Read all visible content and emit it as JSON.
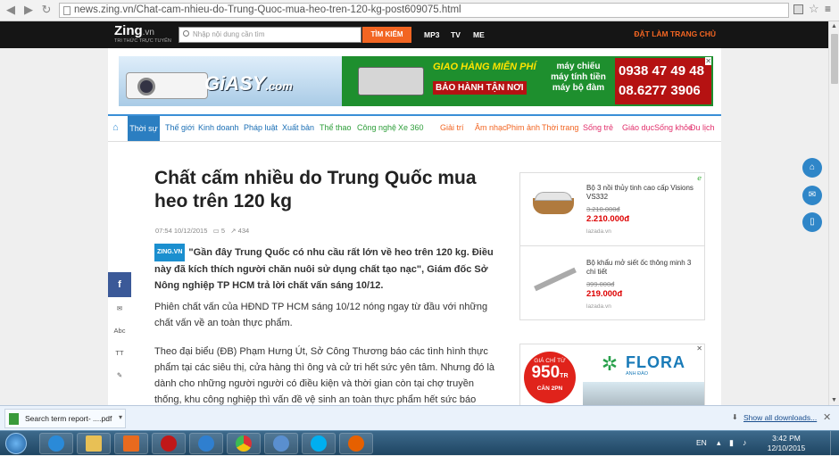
{
  "browser": {
    "url": "news.zing.vn/Chat-cam-nhieu-do-Trung-Quoc-mua-heo-tren-120-kg-post609075.html"
  },
  "topbar": {
    "logo": "Zing",
    "logo_suffix": ".vn",
    "tagline": "TRI THỨC TRỰC TUYẾN",
    "search_placeholder": "Nhập nội dung cần tìm",
    "search_button": "TÌM KIẾM",
    "nav": [
      "MP3",
      "TV",
      "ME"
    ],
    "right_link": "ĐẶT LÀM TRANG CHỦ"
  },
  "banner": {
    "brand": "GiASY",
    "brand_suffix": ".com",
    "promo1": "GIAO HÀNG MIỄN PHÍ",
    "promo2": "BẢO HÀNH TẬN NƠI",
    "products": [
      "máy chiếu",
      "máy tính tiền",
      "máy bộ đàm"
    ],
    "phone1": "0938 47 49 48",
    "phone2": "08.6277 3906"
  },
  "nav": {
    "active": "Thời sự",
    "items": [
      {
        "label": "Thế giới",
        "color": "#1b6fb5"
      },
      {
        "label": "Kinh doanh",
        "color": "#1b6fb5"
      },
      {
        "label": "Pháp luật",
        "color": "#1b6fb5"
      },
      {
        "label": "Xuất bản",
        "color": "#1b6fb5"
      },
      {
        "label": "Thể thao",
        "color": "#2e9e3a"
      },
      {
        "label": "Công nghệ",
        "color": "#2e9e3a"
      },
      {
        "label": "Xe 360",
        "color": "#2e9e3a"
      },
      {
        "label": "Giải trí",
        "color": "#f26522"
      },
      {
        "label": "Âm nhạc",
        "color": "#f26522"
      },
      {
        "label": "Phim ảnh",
        "color": "#f26522"
      },
      {
        "label": "Thời trang",
        "color": "#f26522"
      },
      {
        "label": "Sống trẻ",
        "color": "#e2306c"
      },
      {
        "label": "Giáo dục",
        "color": "#e2306c"
      },
      {
        "label": "Sống khỏe",
        "color": "#e2306c"
      },
      {
        "label": "Du lịch",
        "color": "#e2306c"
      }
    ]
  },
  "article": {
    "title": "Chất cấm nhiều do Trung Quốc mua heo trên 120 kg",
    "time": "07:54 10/12/2015",
    "comments": "5",
    "views": "434",
    "badge": "ZING.VN",
    "sapo": "\"Gần đây Trung Quốc có nhu cầu rất lớn về heo trên 120 kg. Điều này đã kích thích người chăn nuôi sử dụng chất tạo nạc\", Giám đốc Sở Nông nghiệp TP HCM trả lời chất vấn sáng 10/12.",
    "para1": "Phiên chất vấn của HĐND TP HCM sáng 10/12 nóng ngay từ đầu với những chất vấn về an toàn thực phẩm.",
    "para2": "Theo đại biểu (ĐB) Phạm Hưng Út, Sở Công Thương báo các tình hình thực phẩm tại các siêu thị, cửa hàng thì ông và cử tri hết sức yên tâm. Nhưng đó là dành cho những người người có điều kiện và thời gian còn tại chợ truyền thống, khu công nghiệp thì vấn đề vệ sinh an toàn thực phẩm hết sức báo"
  },
  "share": {
    "fb": "f",
    "tools": [
      "Abc",
      "TT"
    ]
  },
  "ads": [
    {
      "name": "Bộ 3 nồi thủy tinh cao cấp Visions VS332",
      "old": "3.210.000đ",
      "price": "2.210.000đ",
      "source": "lazada.vn"
    },
    {
      "name": "Bộ khẩu mở siết ốc thông minh 3 chi tiết",
      "old": "399.000đ",
      "price": "219.000đ",
      "source": "lazada.vn"
    }
  ],
  "flora": {
    "price_label": "GIÁ CHỈ TỪ",
    "price": "950",
    "unit": "TR",
    "size": "CĂN 2PN",
    "brand": "FLORA",
    "sub": "ANH ĐÀO"
  },
  "download": {
    "file": "Search term report- ....pdf",
    "show_all": "Show all downloads..."
  },
  "taskbar": {
    "lang": "EN",
    "time": "3:42 PM",
    "date": "12/10/2015"
  }
}
